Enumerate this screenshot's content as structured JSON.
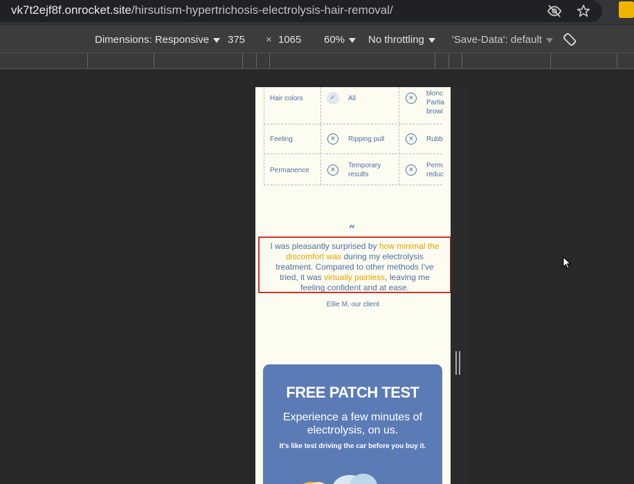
{
  "browser": {
    "url_host": "vk7t2ejf8f.onrocket.site",
    "url_path": "/hirsutism-hypertrichosis-electrolysis-hair-removal/",
    "icons": [
      "eye-off-icon",
      "star-icon",
      "extension-icon"
    ]
  },
  "devtools": {
    "dimensions_label": "Dimensions: Responsive",
    "width": "375",
    "times": "×",
    "height": "1065",
    "zoom": "60%",
    "throttling": "No throttling",
    "save_data": "'Save-Data': default"
  },
  "comparison": {
    "rows": [
      {
        "label": "Hair colors",
        "icon1": "check-icon",
        "col1": "All",
        "icon2": "x-icon",
        "col2_lines": [
          "blonc",
          "Partia",
          "browi"
        ]
      },
      {
        "label": "Feeling",
        "icon1": "x-icon",
        "col1": "Ripping pull",
        "icon2": "x-icon",
        "col2_lines": [
          "Rubb"
        ]
      },
      {
        "label": "Permanence",
        "icon1": "x-icon",
        "col1_lines": [
          "Temporary",
          "results"
        ],
        "icon2": "x-icon",
        "col2_lines": [
          "Perm",
          "reduc"
        ]
      }
    ]
  },
  "testimonial": {
    "quote_mark": "“",
    "part1": "I was pleasantly surprised by ",
    "highlight1": "how minimal the discomfort was",
    "part2": " during my electrolysis treatment. Compared to other methods I've tried, it was ",
    "highlight2": "virtually painless",
    "part3": ", leaving me feeling confident and at ease.",
    "author": "Ellie M, our client"
  },
  "patch_test": {
    "title": "FREE PATCH TEST",
    "subtitle": "Experience a few minutes of electrolysis, on us.",
    "note": "It's like test driving the car before you buy it."
  },
  "colors": {
    "accent_blue": "#4a6fa5",
    "highlight_orange": "#e8a200",
    "card_blue": "#5b7bb6",
    "page_bg": "#fdfcf0",
    "highlight_border": "#d32f2f"
  }
}
